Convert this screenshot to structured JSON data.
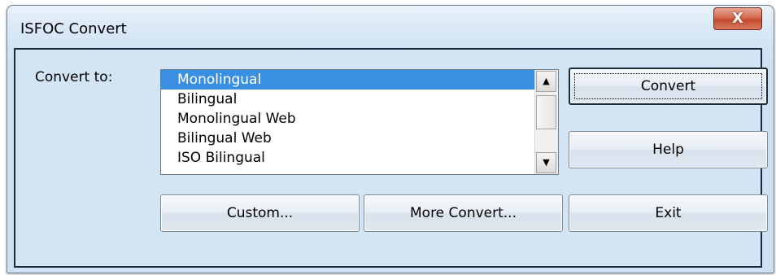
{
  "window": {
    "title": "ISFOC Convert",
    "close_glyph": "X"
  },
  "form": {
    "convert_to_label": "Convert to:"
  },
  "listbox": {
    "items": [
      "Monolingual",
      "Bilingual",
      "Monolingual Web",
      "Bilingual Web",
      "ISO Bilingual"
    ],
    "selected": "Monolingual"
  },
  "scrollbar": {
    "up_glyph": "▲",
    "down_glyph": "▼"
  },
  "buttons": {
    "convert": "Convert",
    "help": "Help",
    "custom": "Custom...",
    "more_convert": "More Convert...",
    "exit": "Exit"
  },
  "icons": {
    "close": "close-icon",
    "scroll_up": "arrow-up-icon",
    "scroll_down": "arrow-down-icon"
  },
  "colors": {
    "selection": "#3b8fe3",
    "client_background": "#d3e5f5",
    "close_button": "#c24a30"
  }
}
